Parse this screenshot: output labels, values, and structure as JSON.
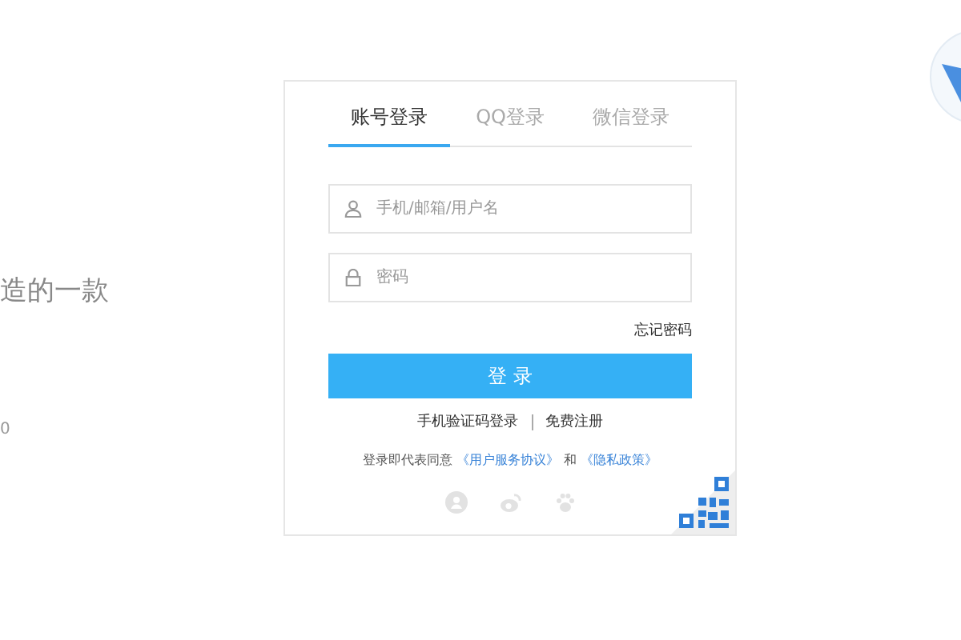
{
  "intro": {
    "tagline": "造的一款",
    "footnote": "0"
  },
  "tabs": [
    {
      "label": "账号登录",
      "selected": true
    },
    {
      "label": "QQ登录",
      "selected": false
    },
    {
      "label": "微信登录",
      "selected": false
    }
  ],
  "fields": [
    {
      "kind": "user",
      "placeholder": "手机/邮箱/用户名"
    },
    {
      "kind": "password",
      "placeholder": "密码"
    }
  ],
  "forgot_link": "忘记密码",
  "login_button": "登 录",
  "alt_links": [
    "手机验证码登录",
    "免费注册"
  ],
  "agreement": {
    "text": "登录即代表同意",
    "link1": "《用户服务协议》",
    "joiner": "和",
    "link2": "《隐私政策》"
  }
}
